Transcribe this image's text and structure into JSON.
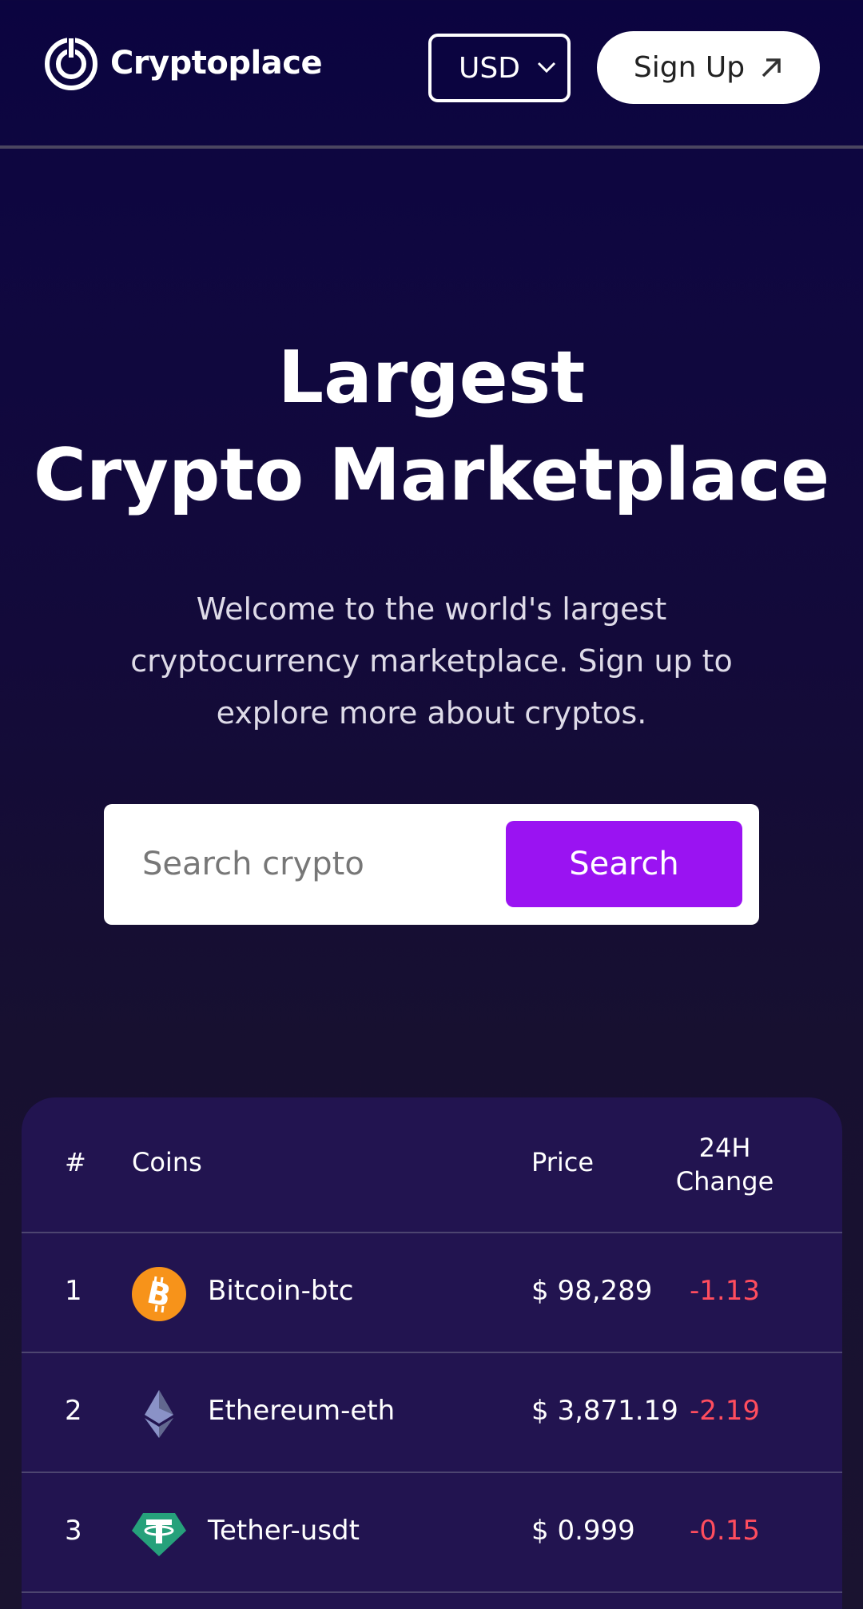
{
  "header": {
    "brand": "Cryptoplace",
    "currency": "USD",
    "signup_label": "Sign Up"
  },
  "hero": {
    "title_line1": "Largest",
    "title_line2": "Crypto Marketplace",
    "subtitle_line1": "Welcome to the world's largest",
    "subtitle_line2": "cryptocurrency marketplace. Sign up to",
    "subtitle_line3": "explore more about cryptos."
  },
  "search": {
    "placeholder": "Search crypto",
    "button_label": "Search"
  },
  "table": {
    "columns": [
      "#",
      "Coins",
      "Price",
      "24H",
      "Change"
    ],
    "rows": [
      {
        "rank": "1",
        "coin": "Bitcoin-btc",
        "price": "$ 98,289",
        "change": "-1.13",
        "icon": "bitcoin-icon",
        "icon_color": "#f7931a"
      },
      {
        "rank": "2",
        "coin": "Ethereum-eth",
        "price": "$ 3,871.19",
        "change": "-2.19",
        "icon": "ethereum-icon",
        "icon_color": "#8a92c7"
      },
      {
        "rank": "3",
        "coin": "Tether-usdt",
        "price": "$ 0.999",
        "change": "-0.15",
        "icon": "tether-icon",
        "icon_color": "#26a17b"
      }
    ]
  },
  "colors": {
    "accent": "#9a13f2",
    "negative": "#ff4d5e",
    "table_bg": "#221450"
  }
}
